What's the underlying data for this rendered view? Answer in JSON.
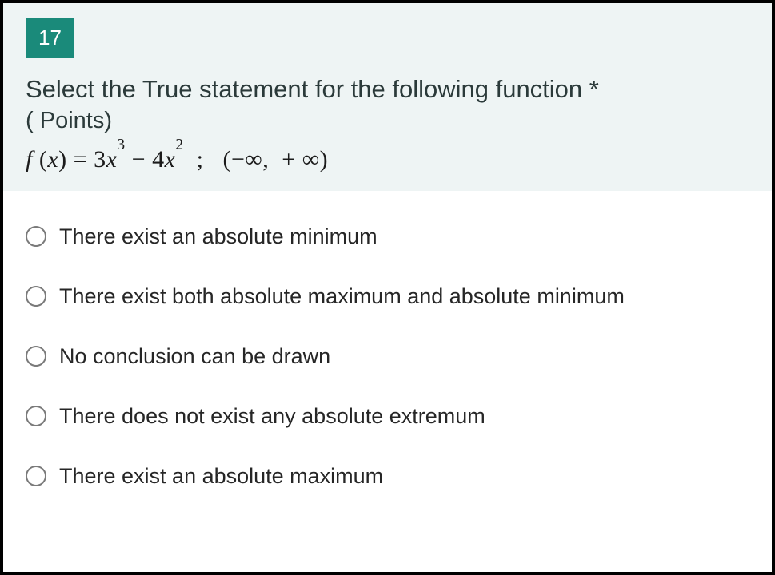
{
  "question": {
    "number": "17",
    "title": "Select the True statement for the following function",
    "required_marker": "*",
    "points_prefix": "(",
    "points_value": " ",
    "points_suffix": "Points)",
    "formula_plain": "f (x) = 3x³ − 4x²  ;   (−∞,  + ∞)"
  },
  "options": [
    {
      "label": "There exist an absolute minimum"
    },
    {
      "label": "There exist both absolute maximum and absolute minimum"
    },
    {
      "label": "No conclusion can be drawn"
    },
    {
      "label": "There does not exist any absolute extremum"
    },
    {
      "label": "There exist an absolute maximum"
    }
  ]
}
